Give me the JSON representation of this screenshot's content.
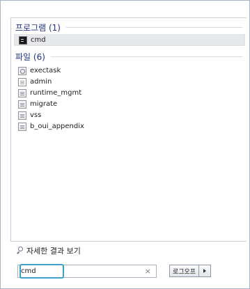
{
  "results": {
    "programs_header": "프로그램 (1)",
    "programs": [
      {
        "label": "cmd",
        "icon": "cmd-icon"
      }
    ],
    "files_header": "파일 (6)",
    "files": [
      {
        "label": "exectask",
        "icon": "settings-file-icon"
      },
      {
        "label": "admin",
        "icon": "text-file-icon"
      },
      {
        "label": "runtime_mgmt",
        "icon": "document-icon"
      },
      {
        "label": "migrate",
        "icon": "document-icon"
      },
      {
        "label": "vss",
        "icon": "document-icon"
      },
      {
        "label": "b_oui_appendix",
        "icon": "document-icon"
      }
    ]
  },
  "see_more": "자세한 결과 보기",
  "search": {
    "value": "cmd",
    "clear_glyph": "×"
  },
  "shutdown": {
    "label": "로그오프"
  },
  "colors": {
    "header_text": "#1e3287",
    "focus_ring": "#3aa0c8",
    "selected_bg": "#e6e8eb"
  }
}
